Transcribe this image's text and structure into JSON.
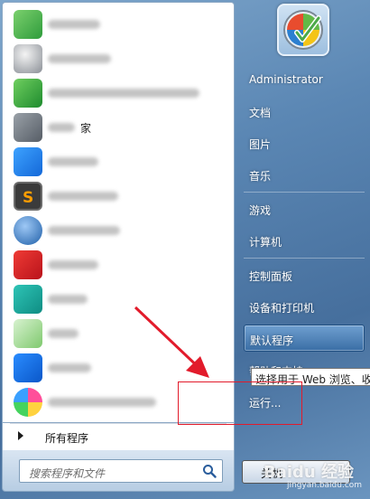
{
  "user": {
    "name": "Administrator"
  },
  "left_pane": {
    "apps": [
      {
        "icon": "app-icon-green",
        "label": ""
      },
      {
        "icon": "app-icon-network",
        "label": ""
      },
      {
        "icon": "app-icon-green-box",
        "label": ""
      },
      {
        "icon": "app-icon-folder",
        "label": "家"
      },
      {
        "icon": "app-icon-blue-pen",
        "label": ""
      },
      {
        "icon": "sublime-text-icon",
        "label": ""
      },
      {
        "icon": "app-icon-globe",
        "label": ""
      },
      {
        "icon": "app-icon-red",
        "label": ""
      },
      {
        "icon": "app-icon-teal-camera",
        "label": ""
      },
      {
        "icon": "app-icon-green-plus",
        "label": ""
      },
      {
        "icon": "shield-icon",
        "label": ""
      },
      {
        "icon": "app-icon-colorful-flower",
        "label": ""
      }
    ],
    "all_programs_label": "所有程序",
    "search_placeholder": "搜索程序和文件"
  },
  "right_pane": {
    "items": [
      {
        "label": "Administrator"
      },
      {
        "label": "文档"
      },
      {
        "label": "图片"
      },
      {
        "label": "音乐"
      },
      {
        "label": "游戏"
      },
      {
        "label": "计算机"
      },
      {
        "label": "控制面板"
      },
      {
        "label": "设备和打印机"
      },
      {
        "label": "默认程序"
      },
      {
        "label": "帮助和支持"
      },
      {
        "label": "运行..."
      }
    ],
    "tooltip": "选择用于 Web 浏览、收",
    "shutdown_label": "关机"
  },
  "watermark": {
    "text": "Baidu 经验",
    "sub": "jingyan.baidu.com"
  },
  "colors": {
    "accent": "#3a6ea5",
    "annotation_red": "#e21b2b"
  }
}
